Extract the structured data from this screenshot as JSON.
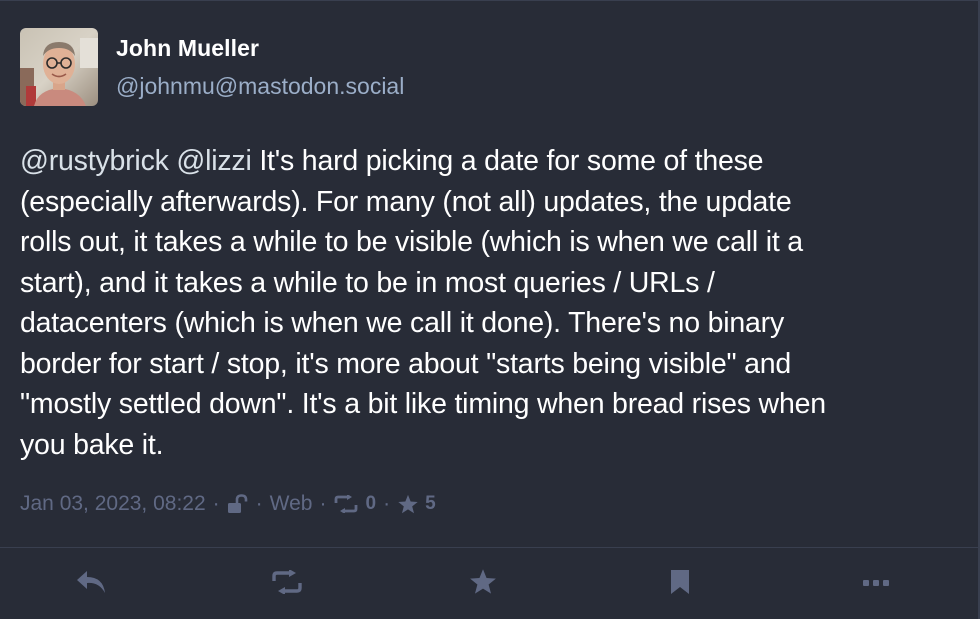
{
  "author": {
    "display_name": "John Mueller",
    "handle": "@johnmu@mastodon.social"
  },
  "post": {
    "mention_1": "@rustybrick",
    "mention_2": "@lizzi",
    "line_1_rest": " It's hard picking a date for some of these",
    "line_2": "(especially afterwards). For many (not all) updates, the update",
    "line_3": "rolls out, it takes a while to be visible (which is when we call it a",
    "line_4": "start), and it takes a while to be in most queries / URLs /",
    "line_5": "datacenters (which is when we call it done). There's no binary",
    "line_6": "border for start / stop, it's more about \"starts being visible\" and",
    "line_7": "\"mostly settled down\". It's a bit like timing when bread rises when",
    "line_8": "you bake it."
  },
  "meta": {
    "timestamp": "Jan 03, 2023, 08:22",
    "separator": "·",
    "visibility_icon": "unlock-icon",
    "application": "Web",
    "boost_count": "0",
    "favourite_count": "5"
  },
  "actions": [
    {
      "name": "reply",
      "icon": "reply-icon"
    },
    {
      "name": "boost",
      "icon": "retweet-icon"
    },
    {
      "name": "favourite",
      "icon": "star-icon"
    },
    {
      "name": "bookmark",
      "icon": "bookmark-icon"
    },
    {
      "name": "more",
      "icon": "ellipsis-icon"
    }
  ],
  "colors": {
    "background": "#282c37",
    "text": "#ffffff",
    "secondary": "#9baec8",
    "muted": "#606984",
    "action_icon": "#8c8dff"
  }
}
